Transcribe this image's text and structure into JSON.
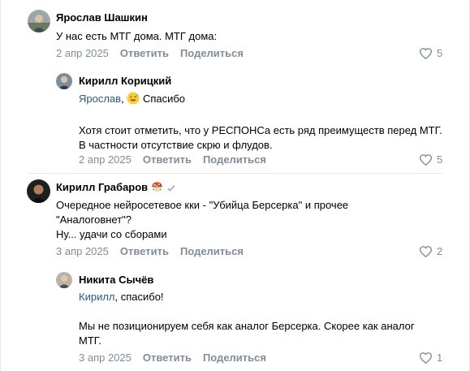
{
  "actions": {
    "reply": "Ответить",
    "share": "Поделиться"
  },
  "colors": {
    "link": "#2a5885",
    "meta": "#818c99",
    "divider": "#e7e8ec"
  },
  "comments": [
    {
      "author": "Ярослав Шашкин",
      "text": [
        "У нас есть МТГ дома. МТГ дома:"
      ],
      "date": "2 апр 2025",
      "likes": "5",
      "avatar_icon": "user-avatar"
    },
    {
      "author": "Кирилл Корицкий",
      "mention": "Ярослав",
      "after_mention": ", ",
      "emoji_icon": "sweat-smile-emoji",
      "thanks": "Спасибо",
      "text2": "Хотя стоит отметить, что у РЕСПОНСа есть ряд преимуществ перед МТГ. В частности отсутствие скрю и флудов.",
      "date": "2 апр 2025",
      "likes": "5",
      "avatar_icon": "user-avatar"
    },
    {
      "author": "Кирилл Грабаров",
      "badge_icon": "mushroom-badge-icon",
      "verified_icon": "checkmark-icon",
      "text": [
        "Очередное нейросетевое кки - \"Убийца Берсерка\" и прочее \"Аналоговнет\"?",
        "Ну... удачи со сборами"
      ],
      "date": "3 апр 2025",
      "likes": "2",
      "avatar_icon": "user-avatar"
    },
    {
      "author": "Никита Сычёв",
      "mention": "Кирилл",
      "after_mention": ", спасибо!",
      "text2": "Мы не позиционируем себя как аналог Берсерка. Скорее как аналог МТГ.",
      "date": "3 апр 2025",
      "likes": "1",
      "avatar_icon": "user-avatar"
    }
  ]
}
